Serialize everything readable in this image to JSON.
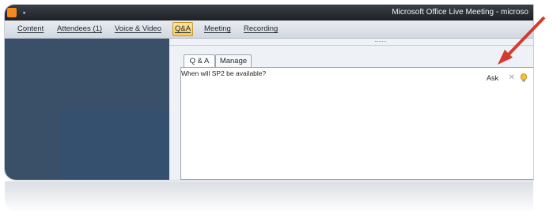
{
  "window": {
    "title": "Microsoft Office Live Meeting - microso",
    "app_icon": "live-meeting-logo-icon",
    "system_menu_glyph": "▪"
  },
  "menu": {
    "items": [
      {
        "label": "Content"
      },
      {
        "label": "Attendees (1)"
      },
      {
        "label": "Voice & Video"
      },
      {
        "label": "Q&A",
        "active": true
      },
      {
        "label": "Meeting"
      },
      {
        "label": "Recording"
      }
    ]
  },
  "qa": {
    "tabs": [
      {
        "label": "Q & A",
        "active": true
      },
      {
        "label": "Manage"
      }
    ],
    "question_text": "When will SP2 be available?",
    "ask_label": "Ask",
    "clear_glyph": "✕",
    "suggestion_icon": "lightbulb-icon"
  },
  "annotation": {
    "arrow_color": "#d23b2e"
  }
}
